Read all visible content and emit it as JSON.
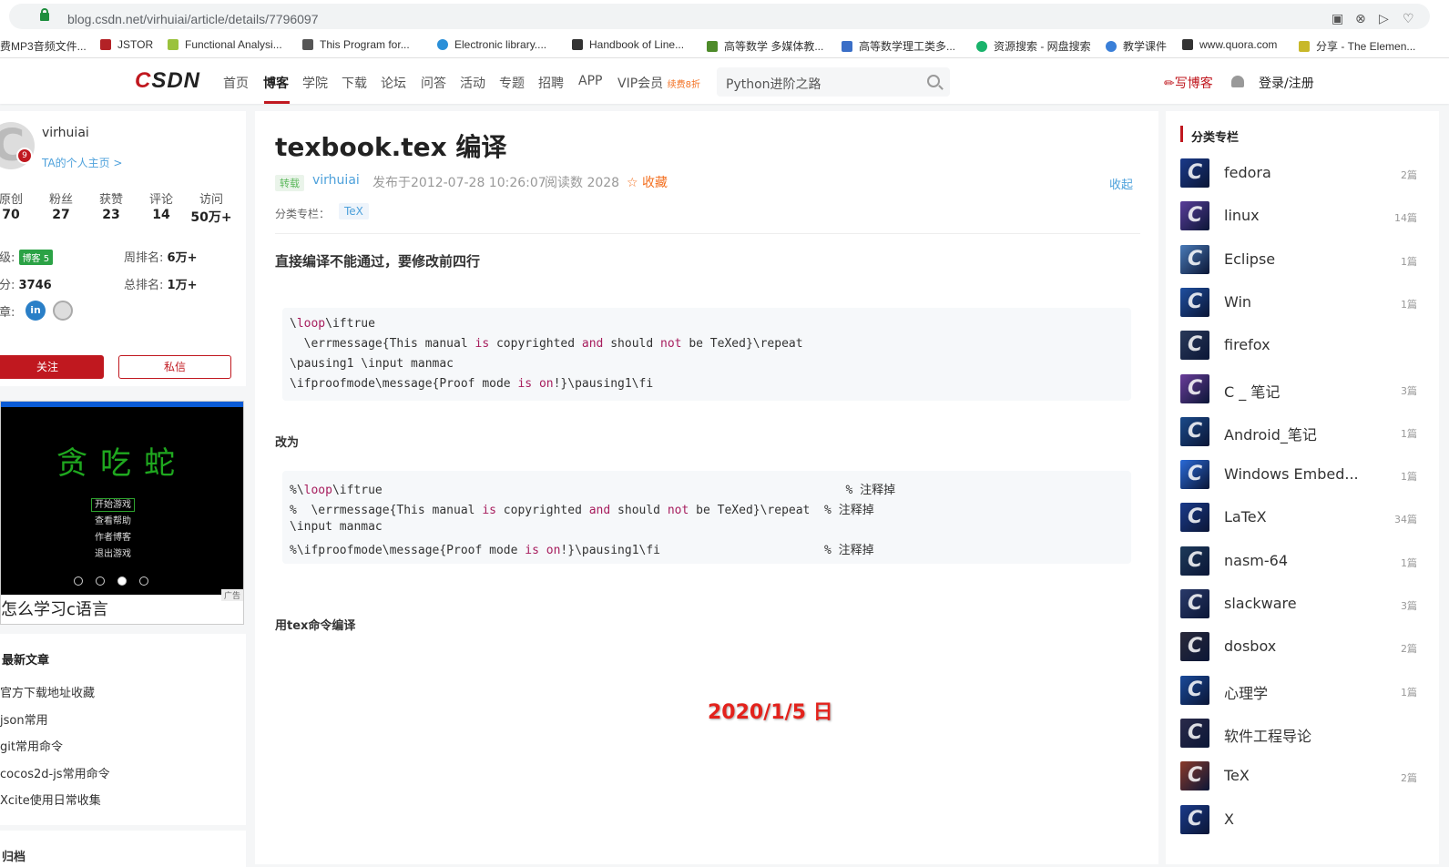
{
  "browser": {
    "url": "blog.csdn.net/virhuiai/article/details/7796097"
  },
  "bookmarks": [
    {
      "label": "费MP3音频文件...",
      "color": "#4a7fd8"
    },
    {
      "label": "JSTOR",
      "color": "#b32226"
    },
    {
      "label": "Functional Analysi...",
      "color": "#9ac23c"
    },
    {
      "label": "This Program for...",
      "color": "#555555"
    },
    {
      "label": "Electronic library....",
      "color": "#2a8fd8"
    },
    {
      "label": "Handbook of Line...",
      "color": "#333333"
    },
    {
      "label": "高等数学 多媒体教...",
      "color": "#4e8b2a"
    },
    {
      "label": "高等数学理工类多...",
      "color": "#3b6fc7"
    },
    {
      "label": "资源搜索 - 网盘搜索",
      "color": "#19b36b"
    },
    {
      "label": "教学课件",
      "color": "#3a7fd8"
    },
    {
      "label": "www.quora.com",
      "color": "#333333"
    },
    {
      "label": "分享 - The Elemen...",
      "color": "#c8b82a"
    }
  ],
  "nav": {
    "logo": "CSDN",
    "items": [
      "首页",
      "博客",
      "学院",
      "下载",
      "论坛",
      "问答",
      "活动",
      "专题",
      "招聘",
      "APP",
      "VIP会员"
    ],
    "vip_badge": "续费8折",
    "search_value": "Python进阶之路",
    "write": "写博客",
    "login": "登录/注册"
  },
  "profile": {
    "username": "virhuiai",
    "homepage": "TA的个人主页 >",
    "avatar_badge": "9",
    "stats": [
      {
        "label": "原创",
        "value": "70"
      },
      {
        "label": "粉丝",
        "value": "27"
      },
      {
        "label": "获赞",
        "value": "23"
      },
      {
        "label": "评论",
        "value": "14"
      },
      {
        "label": "访问",
        "value": "50万+"
      }
    ],
    "level_label": "等级:",
    "level_badge": "博客 5",
    "weekly_rank_label": "周排名:",
    "weekly_rank": "6万+",
    "points_label": "积分:",
    "points": "3746",
    "total_rank_label": "总排名:",
    "total_rank": "1万+",
    "medals_label": "勋章:",
    "follow": "关注",
    "message": "私信"
  },
  "ad": {
    "game_title": "贪吃蛇",
    "menu": [
      "开始游戏",
      "查看帮助",
      "作者博客",
      "退出游戏"
    ],
    "label": "广告",
    "caption": "怎么学习c语言"
  },
  "recent": {
    "title": "最新文章",
    "items": [
      "官方下载地址收藏",
      "json常用",
      "git常用命令",
      "cocos2d-js常用命令",
      "Xcite使用日常收集"
    ]
  },
  "archive": {
    "title": "归档"
  },
  "article": {
    "title": "texbook.tex 编译",
    "repost": "转载",
    "author": "virhuiai",
    "published": "发布于2012-07-28 10:26:07",
    "reads": "阅读数 2028",
    "collect": "收藏",
    "fold": "收起",
    "tags_label": "分类专栏：",
    "tag": "TeX",
    "para1": "直接编译不能通过，要修改前四行",
    "para2": "改为",
    "para3": "用tex命令编译",
    "date_stamp": "2020/1/5 日"
  },
  "categories": {
    "title": "分类专栏",
    "items": [
      {
        "name": "fedora",
        "count": "2篇",
        "color": "#1a3a8a"
      },
      {
        "name": "linux",
        "count": "14篇",
        "color": "#5a3d9a"
      },
      {
        "name": "Eclipse",
        "count": "1篇",
        "color": "#4a7bb8"
      },
      {
        "name": "Win",
        "count": "1篇",
        "color": "#1f4fa0"
      },
      {
        "name": "firefox",
        "count": "",
        "color": "#2a3a5a"
      },
      {
        "name": "C _ 笔记",
        "count": "3篇",
        "color": "#6a3d9a"
      },
      {
        "name": "Android_笔记",
        "count": "1篇",
        "color": "#1a4a8a"
      },
      {
        "name": "Windows Embed...",
        "count": "1篇",
        "color": "#2a6ad8"
      },
      {
        "name": "LaTeX",
        "count": "34篇",
        "color": "#1a3a8a"
      },
      {
        "name": "nasm-64",
        "count": "1篇",
        "color": "#1d3a5a"
      },
      {
        "name": "slackware",
        "count": "3篇",
        "color": "#2a3a6a"
      },
      {
        "name": "dosbox",
        "count": "2篇",
        "color": "#2a2a3a"
      },
      {
        "name": "心理学",
        "count": "1篇",
        "color": "#1a4a9a"
      },
      {
        "name": "软件工程导论",
        "count": "",
        "color": "#2a2a4a"
      },
      {
        "name": "TeX",
        "count": "2篇",
        "color": "#8a3a2a"
      },
      {
        "name": "X",
        "count": "",
        "color": "#1a3a8a"
      }
    ]
  }
}
